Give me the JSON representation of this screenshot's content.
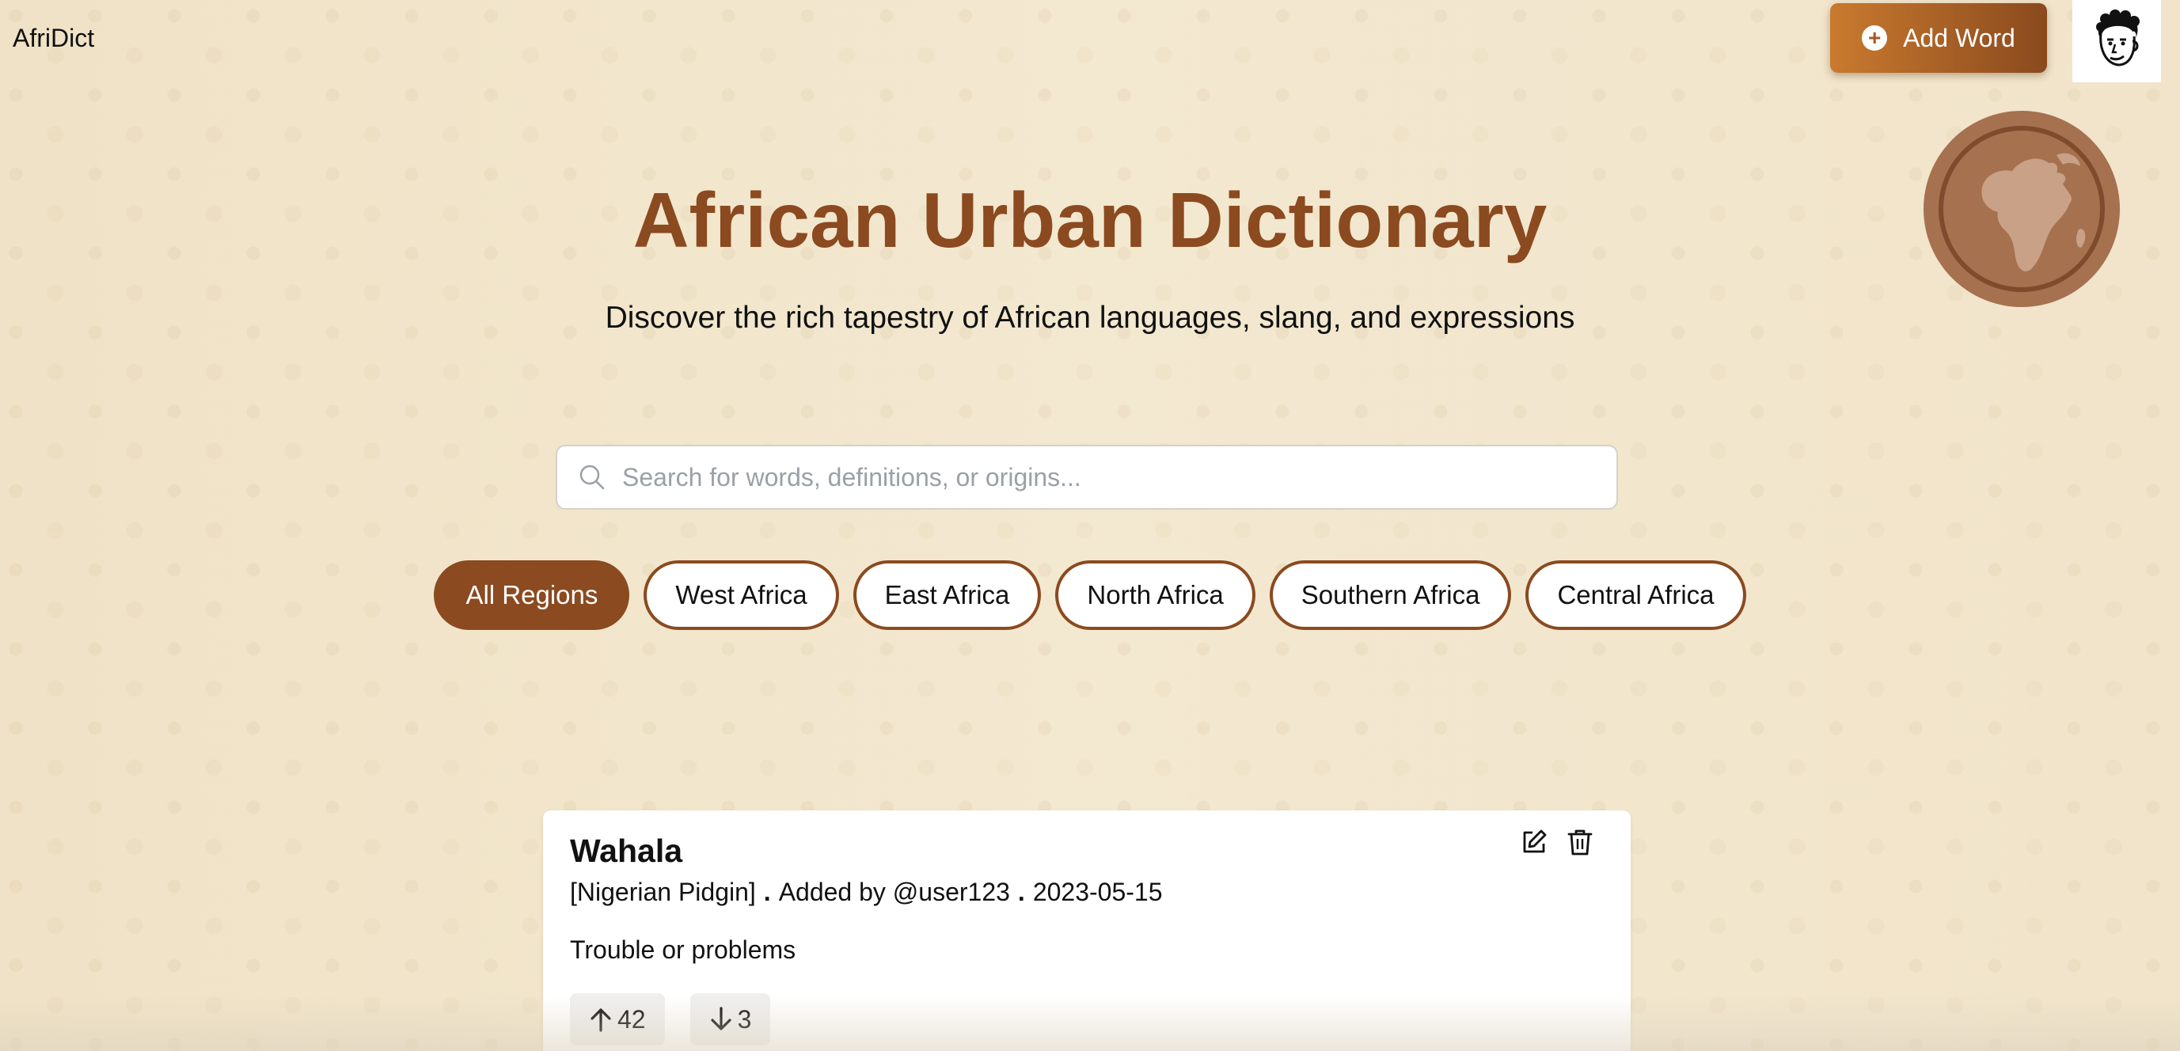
{
  "app": {
    "brand": "AfriDict"
  },
  "header": {
    "add_word_label": "Add Word",
    "avatar_icon": "avatar-icon"
  },
  "hero": {
    "title": "African Urban Dictionary",
    "subtitle": "Discover the rich tapestry of African languages, slang, and expressions",
    "globe_icon": "africa-globe-icon"
  },
  "search": {
    "placeholder": "Search for words, definitions, or origins...",
    "value": ""
  },
  "regions": [
    {
      "label": "All Regions",
      "active": true
    },
    {
      "label": "West Africa",
      "active": false
    },
    {
      "label": "East Africa",
      "active": false
    },
    {
      "label": "North Africa",
      "active": false
    },
    {
      "label": "Southern Africa",
      "active": false
    },
    {
      "label": "Central Africa",
      "active": false
    }
  ],
  "entries": [
    {
      "word": "Wahala",
      "language": "[Nigerian Pidgin]",
      "added_by": "Added by @user123",
      "date": "2023-05-15",
      "separator": ".",
      "definition": "Trouble or problems",
      "upvotes": "42",
      "downvotes": "3"
    }
  ],
  "colors": {
    "accent": "#8b4a1f",
    "button_gradient_start": "#c97a2e",
    "button_gradient_end": "#8a4a1e",
    "background": "#f2e6cc"
  }
}
